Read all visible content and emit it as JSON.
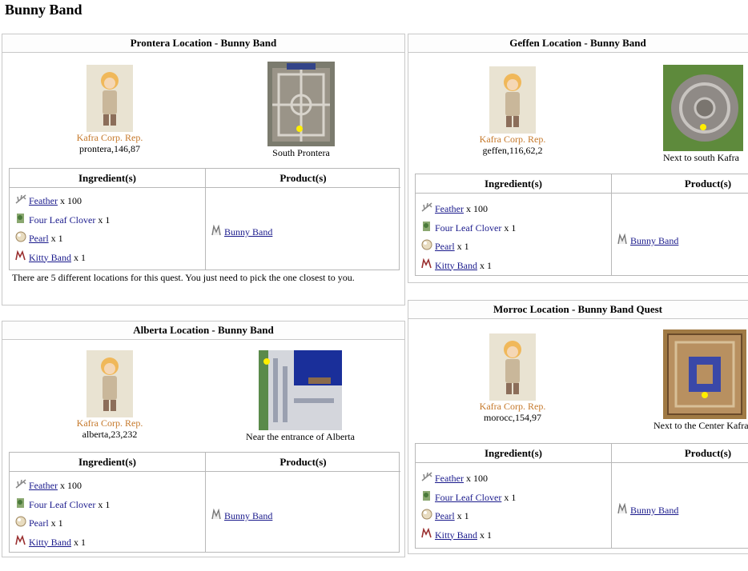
{
  "page": {
    "title": "Bunny Band"
  },
  "labels": {
    "ingredients": "Ingredient(s)",
    "products": "Product(s)",
    "npc_name": "Kafra Corp. Rep."
  },
  "ingredients": [
    {
      "name": "Feather",
      "qty": "x 100",
      "linked": true,
      "icon": "feather-icon"
    },
    {
      "name": "Four Leaf Clover",
      "qty": "x 1",
      "linked": false,
      "icon": "clover-icon"
    },
    {
      "name": "Pearl",
      "qty": "x 1",
      "linked": true,
      "icon": "pearl-icon"
    },
    {
      "name": "Kitty Band",
      "qty": "x 1",
      "linked": true,
      "icon": "kitty-band-icon"
    }
  ],
  "product": {
    "name": "Bunny Band",
    "icon": "bunny-band-icon"
  },
  "panels": {
    "prontera": {
      "title": "Prontera Location - Bunny Band",
      "coord": "prontera,146,87",
      "caption": "South Prontera",
      "note": "There are 5 different locations for this quest. You just need to pick the one closest to you."
    },
    "geffen": {
      "title": "Geffen Location - Bunny Band",
      "coord": "geffen,116,62,2",
      "caption": "Next to south Kafra"
    },
    "alberta": {
      "title": "Alberta Location - Bunny Band",
      "coord": "alberta,23,232",
      "caption": "Near the entrance of Alberta"
    },
    "morroc": {
      "title": "Morroc Location - Bunny Band Quest",
      "coord": "morocc,154,97",
      "caption": "Next to the Center Kafra"
    }
  },
  "colors": {
    "link": "#1a1a8c",
    "npc_name": "#c5782a",
    "marker": "#ffee00"
  }
}
